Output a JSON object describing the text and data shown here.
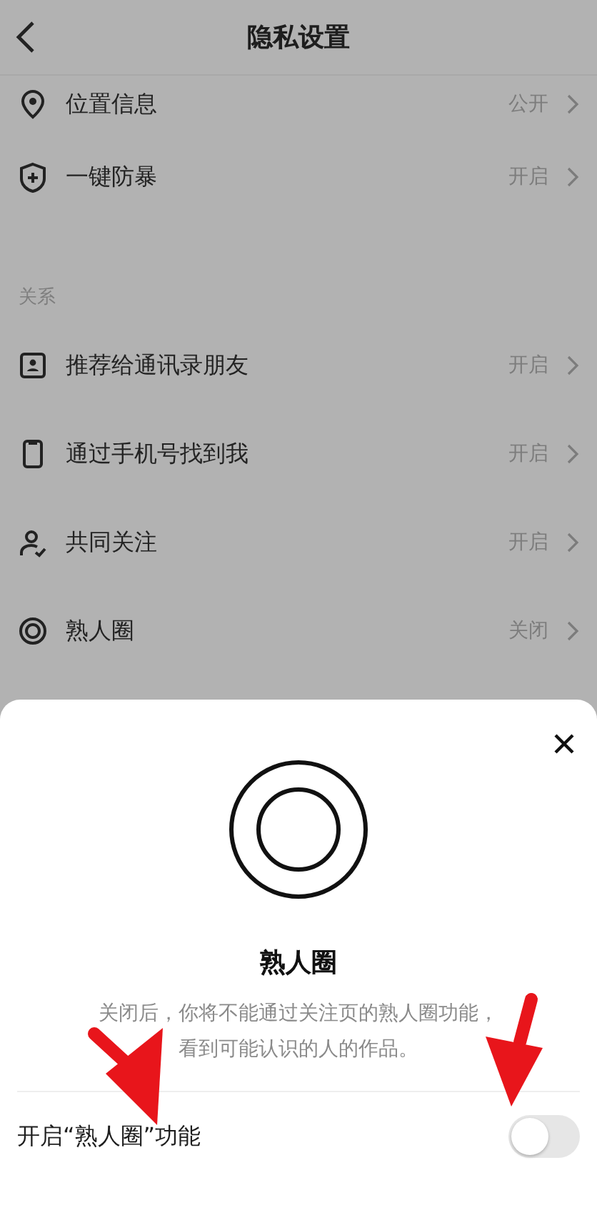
{
  "header": {
    "title": "隐私设置"
  },
  "groups": [
    {
      "rows": [
        {
          "label": "位置信息",
          "value": "公开"
        },
        {
          "label": "一键防暴",
          "value": "开启"
        }
      ]
    },
    {
      "title": "关系",
      "rows": [
        {
          "label": "推荐给通讯录朋友",
          "value": "开启"
        },
        {
          "label": "通过手机号找到我",
          "value": "开启"
        },
        {
          "label": "共同关注",
          "value": "开启"
        },
        {
          "label": "熟人圈",
          "value": "关闭"
        }
      ]
    }
  ],
  "sheet": {
    "title": "熟人圈",
    "description": "关闭后，你将不能通过关注页的熟人圈功能，看到可能认识的人的作品。",
    "toggle": {
      "label": "开启“熟人圈”功能",
      "on": false
    }
  }
}
